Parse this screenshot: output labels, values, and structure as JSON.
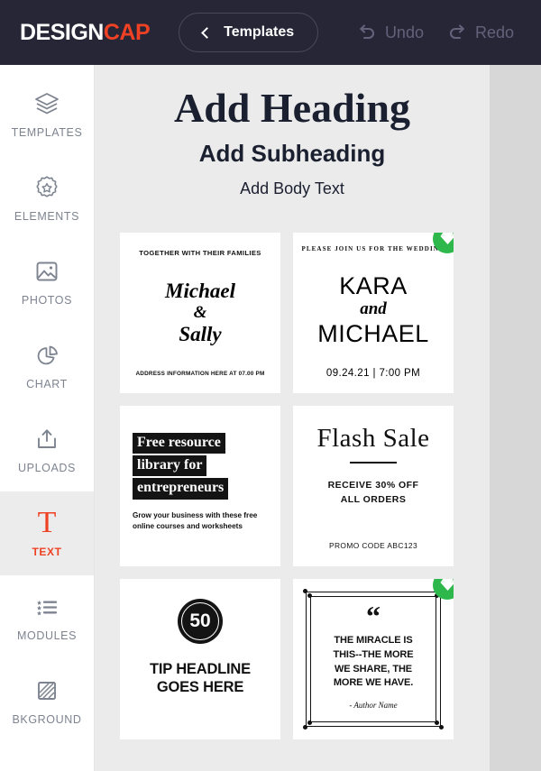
{
  "header": {
    "logo_design": "DESIGN",
    "logo_cap": "CAP",
    "templates_label": "Templates",
    "back_icon": "chevron-left-icon",
    "undo_label": "Undo",
    "redo_label": "Redo",
    "bg_color": "#262637",
    "accent_color": "#ef4123"
  },
  "sidebar": {
    "items": [
      {
        "label": "TEMPLATES",
        "icon": "layers-icon",
        "active": false
      },
      {
        "label": "ELEMENTS",
        "icon": "badge-star-icon",
        "active": false
      },
      {
        "label": "PHOTOS",
        "icon": "image-icon",
        "active": false
      },
      {
        "label": "CHART",
        "icon": "pie-chart-icon",
        "active": false
      },
      {
        "label": "UPLOADS",
        "icon": "upload-icon",
        "active": false
      },
      {
        "label": "TEXT",
        "icon": "text-t-icon",
        "active": true
      },
      {
        "label": "MODULES",
        "icon": "star-list-icon",
        "active": false
      },
      {
        "label": "BKGROUND",
        "icon": "background-icon",
        "active": false
      }
    ]
  },
  "main": {
    "text_presets": {
      "heading": "Add Heading",
      "subheading": "Add Subheading",
      "body": "Add Body Text"
    },
    "templates": [
      {
        "id": "michael-sally-wedding",
        "premium": false,
        "top_line": "TOGETHER WITH THEIR FAMILIES",
        "name_1": "Michael",
        "amp": "&",
        "name_2": "Sally",
        "address": "ADDRESS INFORMATION HERE AT 07.00 PM"
      },
      {
        "id": "kara-michael-wedding",
        "premium": true,
        "top_line": "PLEASE JOIN US FOR THE WEDDING",
        "name_1": "KARA",
        "and": "and",
        "name_2": "MICHAEL",
        "date": "09.24.21  |  7:00 PM"
      },
      {
        "id": "free-resource-library",
        "premium": false,
        "line_1": "Free resource",
        "line_2": "library for",
        "line_3": "entrepreneurs",
        "subtext": "Grow your business with these free online courses and worksheets"
      },
      {
        "id": "flash-sale",
        "premium": false,
        "title": "Flash Sale",
        "offer_line_1": "RECEIVE 30% OFF",
        "offer_line_2": "ALL ORDERS",
        "promo": "PROMO CODE ABC123"
      },
      {
        "id": "tip-headline",
        "premium": false,
        "number": "50",
        "head_line_1": "TIP HEADLINE",
        "head_line_2": "GOES HERE"
      },
      {
        "id": "miracle-quote",
        "premium": true,
        "quote_mark": "“",
        "quote_line_1": "THE MIRACLE IS",
        "quote_line_2": "THIS--THE MORE",
        "quote_line_3": "WE SHARE, THE",
        "quote_line_4": "MORE WE HAVE.",
        "author": "- Author Name"
      }
    ],
    "premium_badge_color": "#2eb84c",
    "premium_badge_icon": "diamond-icon",
    "canvas_bg": "#ebebeb"
  }
}
